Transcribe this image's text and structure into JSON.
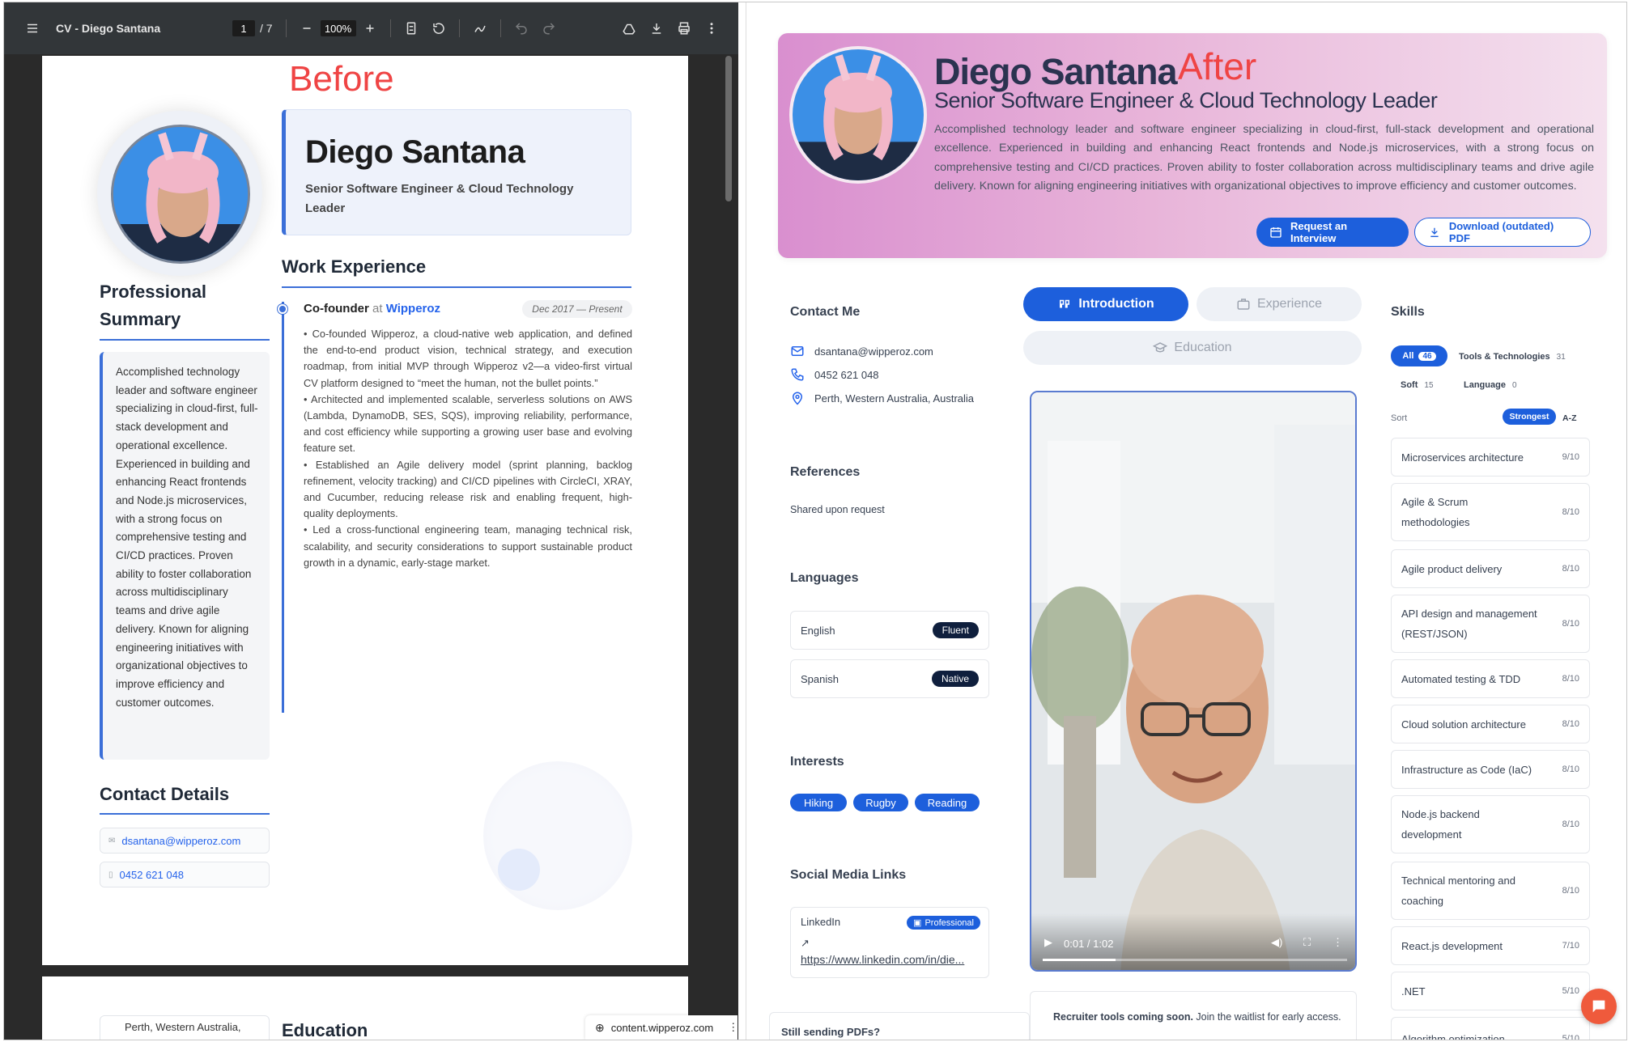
{
  "pdf": {
    "title": "CV - Diego Santana",
    "page": "1",
    "page_total": "/ 7",
    "zoom": "100%",
    "before_label": "Before",
    "name": "Diego Santana",
    "role": "Senior Software Engineer & Cloud Technology Leader",
    "professional_summary_heading": "Professional Summary",
    "summary": "Accomplished technology leader and software engineer specializing in cloud-first, full-stack development and operational excellence. Experienced in building and enhancing React frontends and Node.js microservices, with a strong focus on comprehensive testing and CI/CD practices. Proven ability to foster collaboration across multidisciplinary teams and drive agile delivery. Known for aligning engineering initiatives with organizational objectives to improve efficiency and customer outcomes.",
    "work_heading": "Work Experience",
    "job": {
      "title": "Co-founder",
      "at": "at",
      "company": "Wipperoz",
      "date": "Dec 2017 — Present",
      "bullets": [
        "• Co-founded Wipperoz, a cloud-native web application, and defined the end-to-end product vision, technical strategy, and execution roadmap, from initial MVP through Wipperoz v2—a video-first virtual CV platform designed to “meet the human, not the bullet points.”",
        "• Architected and implemented scalable, serverless solutions on AWS (Lambda, DynamoDB, SES, SQS), improving reliability, performance, and cost efficiency while supporting a growing user base and evolving feature set.",
        "• Established an Agile delivery model (sprint planning, backlog refinement, velocity tracking) and CI/CD pipelines with CircleCI, XRAY, and Cucumber, reducing release risk and enabling frequent, high-quality deployments.",
        "• Led a cross-functional engineering team, managing technical risk, scalability, and security considerations to support sustainable product growth in a dynamic, early-stage market."
      ]
    },
    "contact_heading": "Contact Details",
    "email": "dsantana@wipperoz.com",
    "phone": "0452 621 048",
    "location": "Perth, Western Australia,",
    "education_heading": "Education",
    "url_chip": "content.wipperoz.com"
  },
  "site": {
    "after_label": "After",
    "name": "Diego Santana",
    "title": "Senior Software Engineer & Cloud Technology Leader",
    "summary": "Accomplished technology leader and software engineer specializing in cloud-first, full-stack development and operational excellence. Experienced in building and enhancing React frontends and Node.js microservices, with a strong focus on comprehensive testing and CI/CD practices. Proven ability to foster collaboration across multidisciplinary teams and drive agile delivery. Known for aligning engineering initiatives with organizational objectives to improve efficiency and customer outcomes.",
    "btn_interview": "Request an Interview",
    "btn_pdf": "Download (outdated) PDF",
    "contact_heading": "Contact Me",
    "email": "dsantana@wipperoz.com",
    "phone": "0452 621 048",
    "location": "Perth, Western Australia, Australia",
    "references_heading": "References",
    "references_text": "Shared upon request",
    "languages_heading": "Languages",
    "languages": [
      {
        "name": "English",
        "level": "Fluent"
      },
      {
        "name": "Spanish",
        "level": "Native"
      }
    ],
    "interests_heading": "Interests",
    "interests": [
      "Hiking",
      "Rugby",
      "Reading"
    ],
    "social_heading": "Social Media Links",
    "social": {
      "name": "LinkedIn",
      "badge": "Professional",
      "url": "https://www.linkedin.com/in/die..."
    },
    "still_sending": "Still sending PDFs?",
    "tabs": {
      "intro": "Introduction",
      "experience": "Experience",
      "education": "Education"
    },
    "video_time": "0:01 / 1:02",
    "video_progress": 0.016,
    "recruiter_bold": "Recruiter tools coming soon.",
    "recruiter_rest": " Join the waitlist for early access.",
    "skills_heading": "Skills",
    "filters": {
      "all": "All",
      "all_count": "46",
      "tools": "Tools & Technologies",
      "tools_count": "31",
      "soft": "Soft",
      "soft_count": "15",
      "language": "Language",
      "language_count": "0"
    },
    "sort_label": "Sort",
    "sort_strongest": "Strongest",
    "sort_az": "A-Z",
    "skills": [
      {
        "name": "Microservices architecture",
        "level": "9/10"
      },
      {
        "name": "Agile & Scrum methodologies",
        "level": "8/10"
      },
      {
        "name": "Agile product delivery",
        "level": "8/10"
      },
      {
        "name": "API design and management (REST/JSON)",
        "level": "8/10"
      },
      {
        "name": "Automated testing & TDD",
        "level": "8/10"
      },
      {
        "name": "Cloud solution architecture",
        "level": "8/10"
      },
      {
        "name": "Infrastructure as Code (IaC)",
        "level": "8/10"
      },
      {
        "name": "Node.js backend development",
        "level": "8/10"
      },
      {
        "name": "Technical mentoring and coaching",
        "level": "8/10"
      },
      {
        "name": "React.js development",
        "level": "7/10"
      },
      {
        "name": ".NET",
        "level": "5/10"
      },
      {
        "name": "Algorithm optimization",
        "level": "5/10"
      }
    ]
  }
}
